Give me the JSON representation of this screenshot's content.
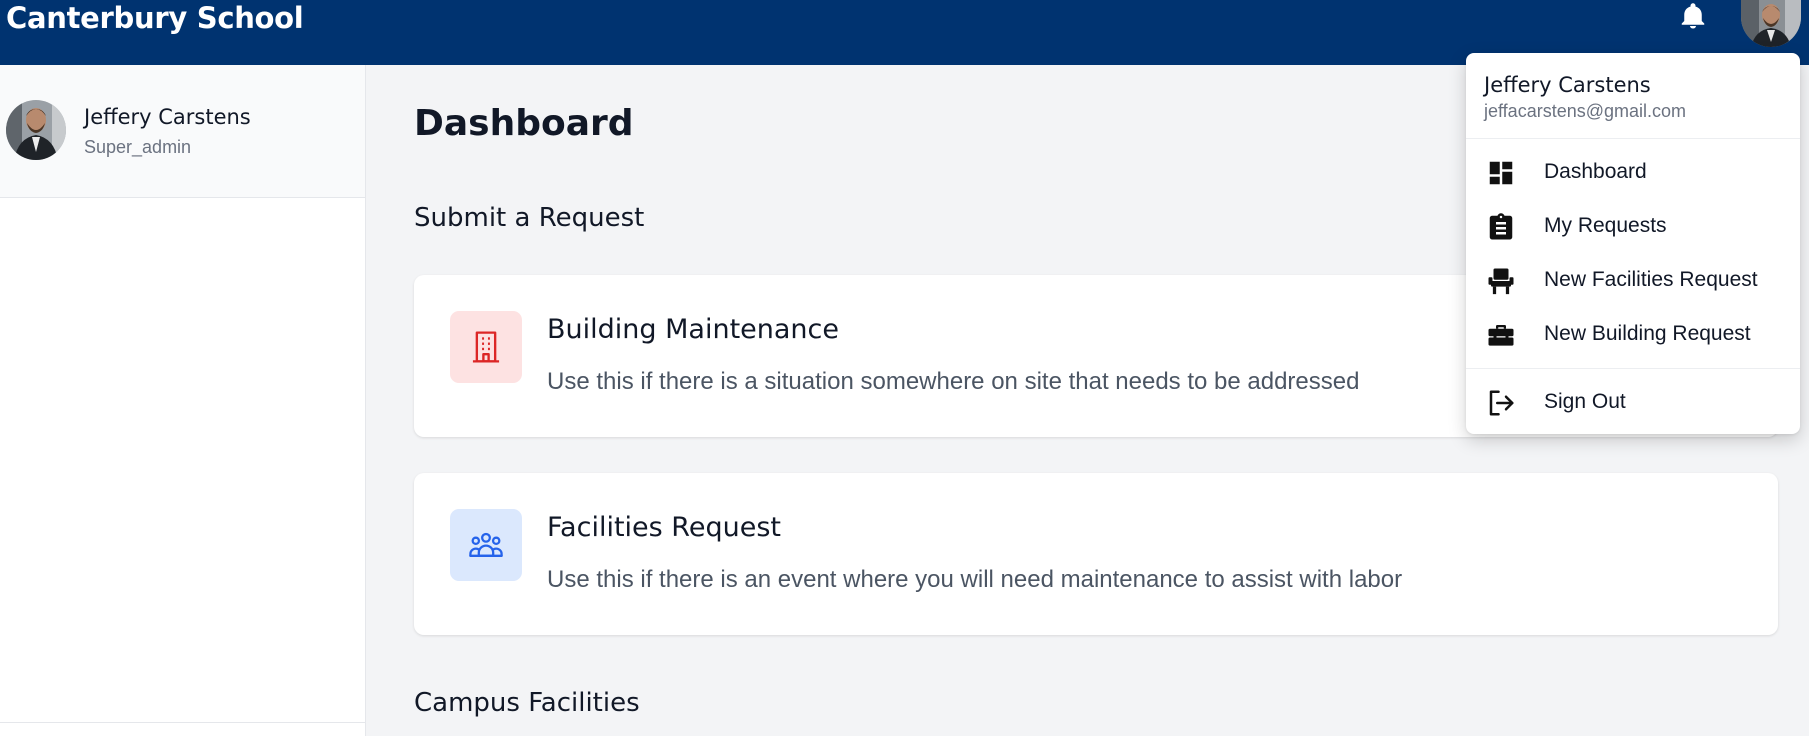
{
  "header": {
    "brand": "Canterbury School",
    "notifications_icon": "bell-icon",
    "avatar_icon": "user-avatar"
  },
  "sidebar": {
    "user_name": "Jeffery Carstens",
    "user_role": "Super_admin"
  },
  "main": {
    "page_title": "Dashboard",
    "submit_section_title": "Submit a Request",
    "cards": [
      {
        "title": "Building Maintenance",
        "description": "Use this if there is a situation somewhere on site that needs to be addressed",
        "icon": "building-icon",
        "icon_bg": "#fde2e2",
        "icon_color": "#dc2626"
      },
      {
        "title": "Facilities Request",
        "description": "Use this if there is an event where you will need maintenance to assist with labor",
        "icon": "people-group-icon",
        "icon_bg": "#dbe8fd",
        "icon_color": "#2563eb"
      }
    ],
    "campus_section_title": "Campus Facilities"
  },
  "dropdown": {
    "user_name": "Jeffery Carstens",
    "user_email": "jeffacarstens@gmail.com",
    "items": [
      {
        "label": "Dashboard",
        "icon": "dashboard-icon"
      },
      {
        "label": "My Requests",
        "icon": "clipboard-icon"
      },
      {
        "label": "New Facilities Request",
        "icon": "chair-icon"
      },
      {
        "label": "New Building Request",
        "icon": "toolbox-icon"
      }
    ],
    "sign_out_label": "Sign Out",
    "sign_out_icon": "sign-out-icon"
  },
  "colors": {
    "header_bg": "#003370",
    "page_bg": "#f3f4f6"
  }
}
